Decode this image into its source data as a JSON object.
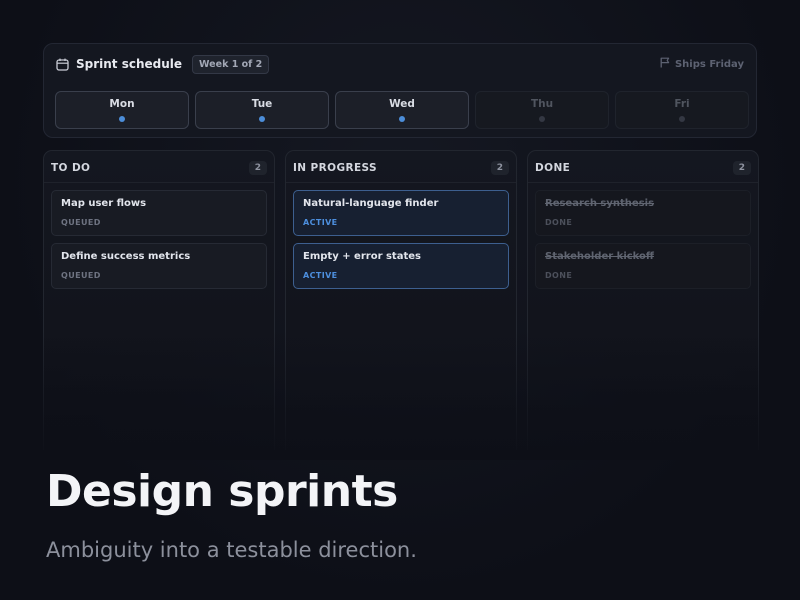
{
  "schedule": {
    "title": "Sprint schedule",
    "week_badge": "Week 1 of 2",
    "ships_label": "Ships Friday",
    "days": [
      {
        "label": "Mon",
        "active": true
      },
      {
        "label": "Tue",
        "active": true
      },
      {
        "label": "Wed",
        "active": true
      },
      {
        "label": "Thu",
        "active": false
      },
      {
        "label": "Fri",
        "active": false
      }
    ]
  },
  "board": {
    "columns": [
      {
        "title": "TO DO",
        "count": "2",
        "cards": [
          {
            "title": "Map user flows",
            "status": "QUEUED",
            "state": "queued"
          },
          {
            "title": "Define success metrics",
            "status": "QUEUED",
            "state": "queued"
          }
        ]
      },
      {
        "title": "IN PROGRESS",
        "count": "2",
        "cards": [
          {
            "title": "Natural-language finder",
            "status": "ACTIVE",
            "state": "active"
          },
          {
            "title": "Empty + error states",
            "status": "ACTIVE",
            "state": "active"
          }
        ]
      },
      {
        "title": "DONE",
        "count": "2",
        "cards": [
          {
            "title": "Research synthesis",
            "status": "DONE",
            "state": "done"
          },
          {
            "title": "Stakeholder kickoff",
            "status": "DONE",
            "state": "done"
          }
        ]
      }
    ]
  },
  "hero": {
    "title": "Design sprints",
    "subtitle": "Ambiguity into a testable direction."
  },
  "colors": {
    "accent": "#4c8dd8",
    "background": "#0d0f17"
  },
  "icons": {
    "schedule": "calendar-icon",
    "ships": "flag-icon"
  }
}
